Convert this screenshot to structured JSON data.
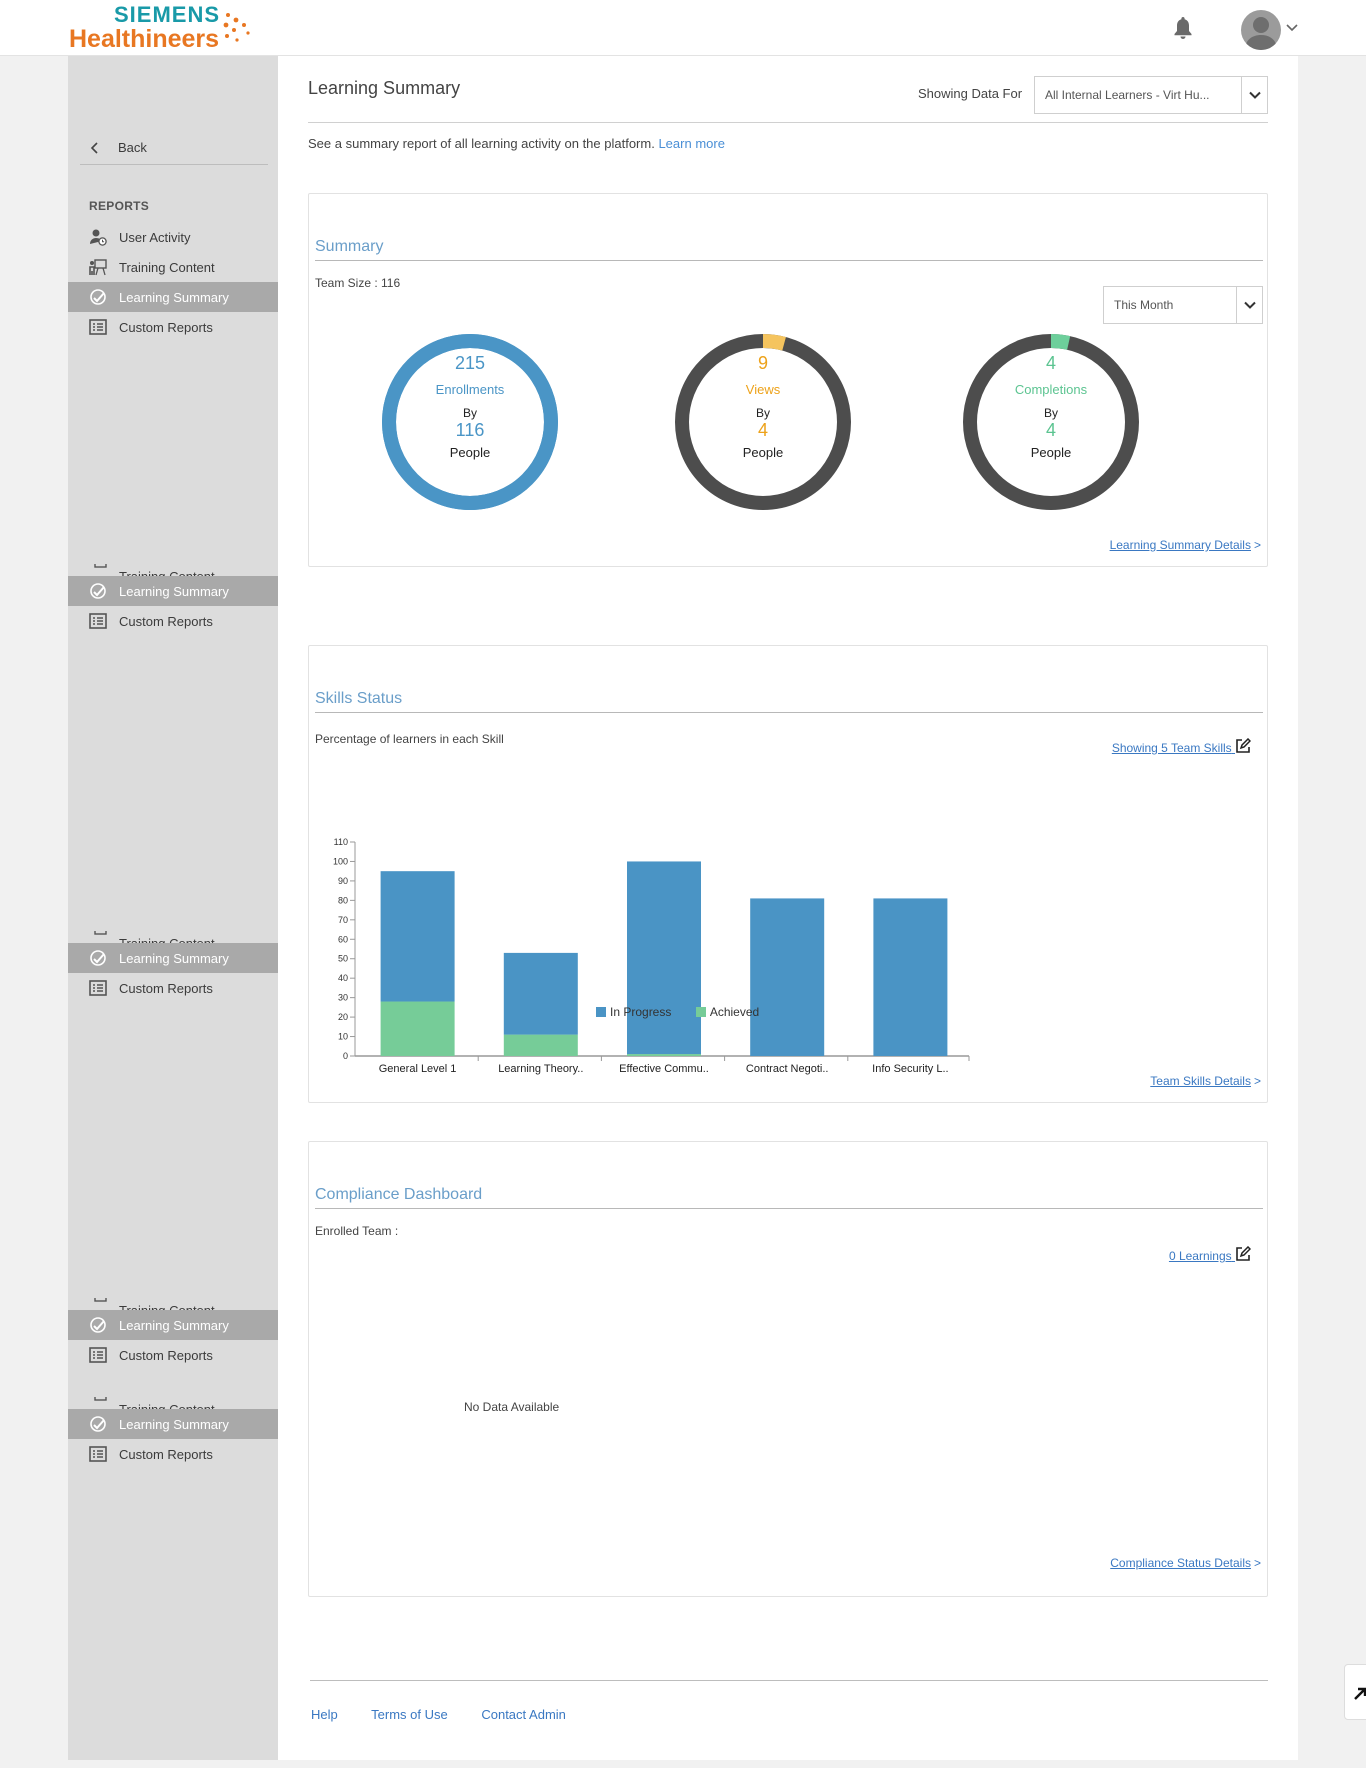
{
  "header": {
    "brand_line1": "SIEMENS",
    "brand_line2": "Healthineers"
  },
  "sidebar": {
    "back_label": "Back",
    "heading": "REPORTS",
    "items": [
      {
        "label": "User Activity",
        "icon": "user-clock-icon"
      },
      {
        "label": "Training Content",
        "icon": "presentation-board-icon"
      },
      {
        "label": "Learning Summary",
        "icon": "gauge-icon",
        "active": true
      },
      {
        "label": "Custom Reports",
        "icon": "report-list-icon"
      }
    ]
  },
  "page": {
    "title": "Learning Summary",
    "showing_label": "Showing Data For",
    "showing_value": "All Internal Learners - Virt Hu...",
    "intro_text": "See a summary report of all learning activity on the platform.",
    "learn_more": "Learn more"
  },
  "summary": {
    "title": "Summary",
    "team_size": "Team Size : 116",
    "period": "This Month",
    "by_label": "By",
    "people_label": "People",
    "donuts": [
      {
        "count": "215",
        "label": "Enrollments",
        "people": "116",
        "color": "#4a95c6",
        "fraction": 1.0
      },
      {
        "count": "9",
        "label": "Views",
        "people": "4",
        "color": "#eda21a",
        "highlight": "#f5c45e",
        "fraction": 0.042
      },
      {
        "count": "4",
        "label": "Completions",
        "people": "4",
        "color": "#5cc491",
        "highlight": "#6dcf9b",
        "fraction": 0.035
      }
    ],
    "details_link": "Learning Summary Details",
    "ring_color": "#4d4d4d"
  },
  "skills": {
    "title": "Skills Status",
    "subtitle": "Percentage of learners in each Skill",
    "showing_link": "Showing 5 Team Skills",
    "details_link": "Team Skills Details"
  },
  "chart_data": {
    "type": "bar",
    "stacked": true,
    "categories": [
      "General Level 1",
      "Learning Theory..",
      "Effective Commu..",
      "Contract Negoti..",
      "Info Security L.."
    ],
    "series": [
      {
        "name": "In Progress",
        "color": "#4a94c5",
        "values": [
          67,
          42,
          99,
          81,
          81
        ]
      },
      {
        "name": "Achieved",
        "color": "#76cc98",
        "values": [
          28,
          11,
          1,
          0,
          0
        ]
      }
    ],
    "ylim": [
      0,
      110
    ],
    "yticks": [
      0,
      10,
      20,
      30,
      40,
      50,
      60,
      70,
      80,
      90,
      100,
      110
    ],
    "legend": "bottom"
  },
  "compliance": {
    "title": "Compliance Dashboard",
    "enrolled_label": "Enrolled Team :",
    "learnings_link": "0 Learnings",
    "empty_text": "No Data Available",
    "details_link": "Compliance Status Details"
  },
  "footer": {
    "links": [
      "Help",
      "Terms of Use",
      "Contact Admin"
    ]
  }
}
